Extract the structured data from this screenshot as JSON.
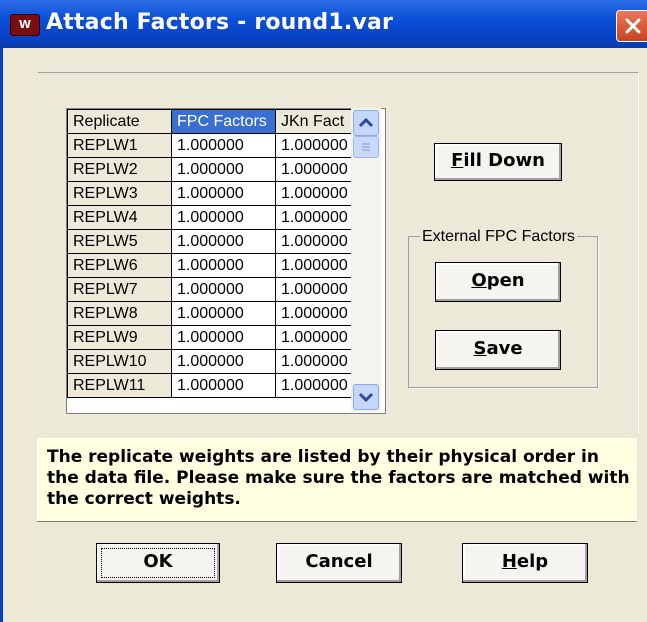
{
  "window": {
    "title": "Attach Factors - round1.var",
    "app_icon": "app-logo-icon",
    "close_icon": "close-icon"
  },
  "grid": {
    "headers": [
      "Replicate",
      "FPC Factors",
      "JKn Fact"
    ],
    "rows": [
      [
        "REPLW1",
        "1.000000",
        "1.000000"
      ],
      [
        "REPLW2",
        "1.000000",
        "1.000000"
      ],
      [
        "REPLW3",
        "1.000000",
        "1.000000"
      ],
      [
        "REPLW4",
        "1.000000",
        "1.000000"
      ],
      [
        "REPLW5",
        "1.000000",
        "1.000000"
      ],
      [
        "REPLW6",
        "1.000000",
        "1.000000"
      ],
      [
        "REPLW7",
        "1.000000",
        "1.000000"
      ],
      [
        "REPLW8",
        "1.000000",
        "1.000000"
      ],
      [
        "REPLW9",
        "1.000000",
        "1.000000"
      ],
      [
        "REPLW10",
        "1.000000",
        "1.000000"
      ],
      [
        "REPLW11",
        "1.000000",
        "1.000000"
      ]
    ]
  },
  "buttons": {
    "fill_down": {
      "mnemonic": "F",
      "rest": "ill Down"
    },
    "open": {
      "mnemonic": "O",
      "rest": "pen"
    },
    "save": {
      "mnemonic": "S",
      "rest": "ave"
    },
    "ok": "OK",
    "cancel": "Cancel",
    "help": {
      "mnemonic": "H",
      "rest": "elp"
    }
  },
  "external_group_label": "External FPC Factors",
  "info_text": "The replicate weights are listed by their physical order in the data file.  Please make sure the factors are matched with the correct weights.",
  "colors": {
    "title_bar": "#0a4fd6",
    "selected_header": "#3a6ed0",
    "info_background": "#ffffe1",
    "dialog_face": "#ece9d8"
  }
}
